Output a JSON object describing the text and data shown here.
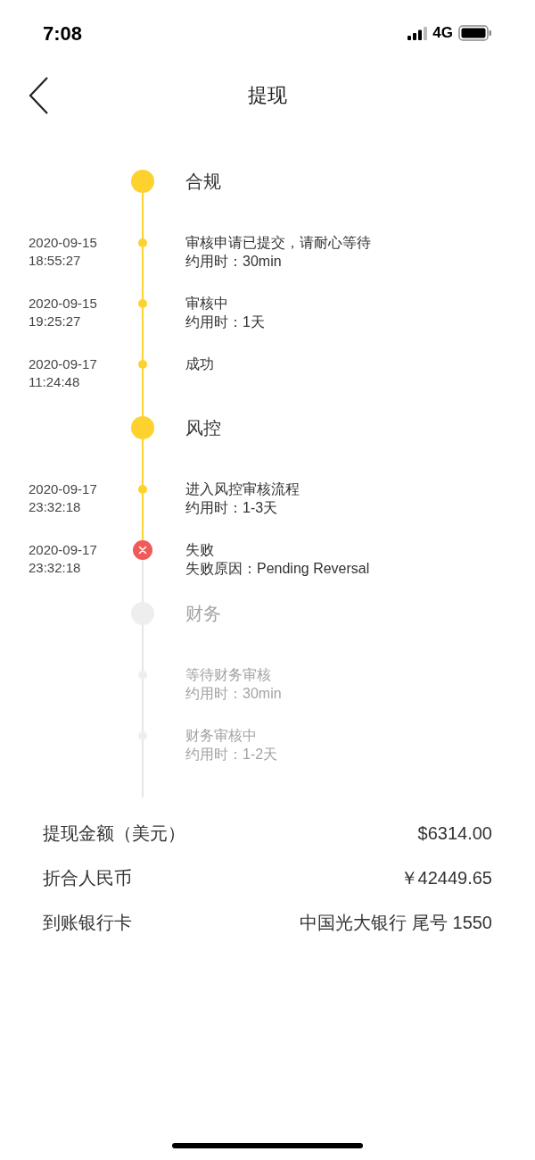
{
  "status_bar": {
    "time": "7:08",
    "network": "4G"
  },
  "nav": {
    "title": "提现"
  },
  "timeline": [
    {
      "kind": "stage",
      "title": "合规",
      "done": true
    },
    {
      "kind": "step",
      "date": "2020-09-15",
      "clock": "18:55:27",
      "title": "审核申请已提交，请耐心等待",
      "detail": "约用时：30min",
      "done": true,
      "failed": false
    },
    {
      "kind": "step",
      "date": "2020-09-15",
      "clock": "19:25:27",
      "title": "审核中",
      "detail": "约用时：1天",
      "done": true,
      "failed": false
    },
    {
      "kind": "step",
      "date": "2020-09-17",
      "clock": "11:24:48",
      "title": "成功",
      "done": true,
      "failed": false
    },
    {
      "kind": "stage",
      "title": "风控",
      "done": true
    },
    {
      "kind": "step",
      "date": "2020-09-17",
      "clock": "23:32:18",
      "title": "进入风控审核流程",
      "detail": "约用时：1-3天",
      "done": true,
      "failed": false
    },
    {
      "kind": "step",
      "date": "2020-09-17",
      "clock": "23:32:18",
      "title": "失败",
      "detail": "失败原因：Pending Reversal",
      "done": false,
      "failed": true
    },
    {
      "kind": "stage",
      "title": "财务",
      "done": false
    },
    {
      "kind": "step",
      "title": "等待财务审核",
      "detail": "约用时：30min",
      "done": false,
      "failed": false
    },
    {
      "kind": "step",
      "title": "财务审核中",
      "detail": "约用时：1-2天",
      "done": false,
      "failed": false
    }
  ],
  "summary": [
    {
      "label": "提现金额（美元）",
      "value": "$6314.00"
    },
    {
      "label": "折合人民币",
      "value": "￥42449.65"
    },
    {
      "label": "到账银行卡",
      "value": "中国光大银行 尾号 1550"
    }
  ]
}
